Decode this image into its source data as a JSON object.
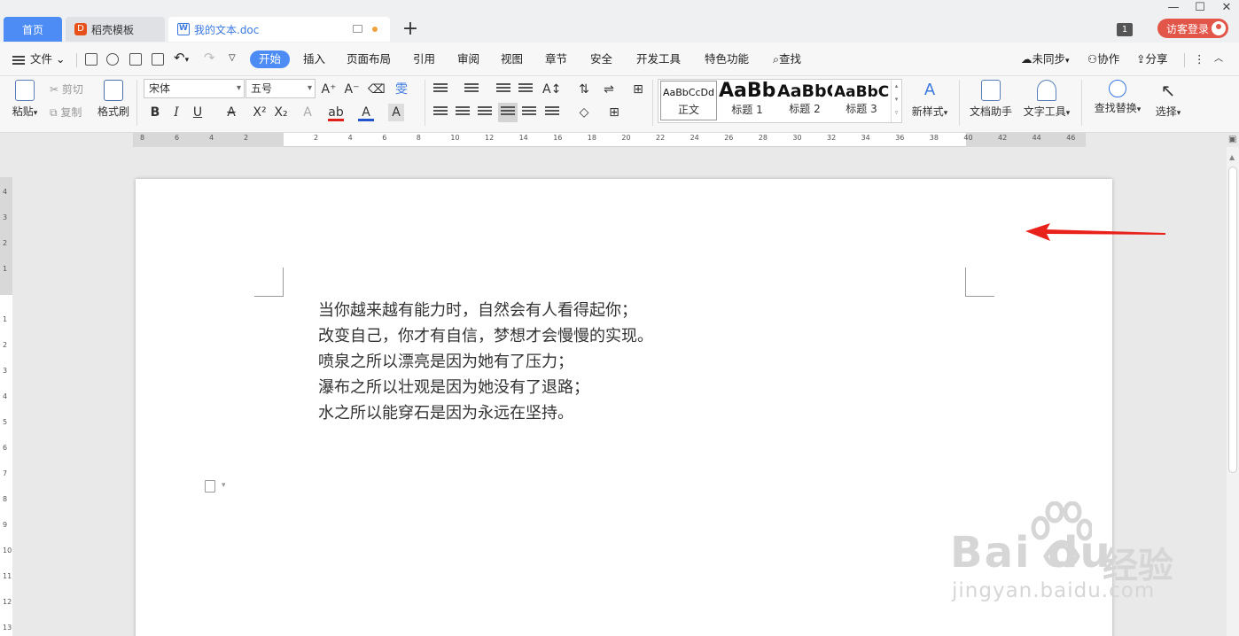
{
  "tabs": {
    "home": "首页",
    "daoke": "稻壳模板",
    "doc": "我的文本.doc"
  },
  "window": {
    "minimize": "—",
    "restore": "☐",
    "close": "✕",
    "badge": "1",
    "login": "访客登录"
  },
  "menu": {
    "file": "文件",
    "items": [
      "开始",
      "插入",
      "页面布局",
      "引用",
      "审阅",
      "视图",
      "章节",
      "安全",
      "开发工具",
      "特色功能"
    ],
    "search": "查找",
    "sync": "未同步",
    "collab": "协作",
    "share": "分享"
  },
  "ribbon": {
    "paste": "粘贴",
    "cut": "剪切",
    "copy": "复制",
    "format_painter": "格式刷",
    "font_name": "宋体",
    "font_size": "五号",
    "styles": [
      {
        "sample": "AaBbCcDd",
        "label": "正文"
      },
      {
        "sample": "AaBb",
        "label": "标题 1"
      },
      {
        "sample": "AaBbC",
        "label": "标题 2"
      },
      {
        "sample": "AaBbCc",
        "label": "标题 3"
      }
    ],
    "new_style": "新样式",
    "doc_helper": "文档助手",
    "text_tools": "文字工具",
    "find_replace": "查找替换",
    "select": "选择"
  },
  "ruler": {
    "h_left": [
      "8",
      "6",
      "4",
      "2"
    ],
    "h_right": [
      "2",
      "4",
      "6",
      "8",
      "10",
      "12",
      "14",
      "16",
      "18",
      "20",
      "22",
      "24",
      "26",
      "28",
      "30",
      "32",
      "34",
      "36",
      "38",
      "40",
      "42",
      "44",
      "46"
    ],
    "v_top": [
      "4",
      "3",
      "2",
      "1"
    ],
    "v_body": [
      "1",
      "2",
      "3",
      "4",
      "5",
      "6",
      "7",
      "8",
      "9",
      "10",
      "11",
      "12",
      "13"
    ]
  },
  "document": {
    "lines": [
      "当你越来越有能力时，自然会有人看得起你；",
      "改变自己，你才有自信，梦想才会慢慢的实现。",
      "喷泉之所以漂亮是因为她有了压力；",
      "瀑布之所以壮观是因为她没有了退路；",
      "水之所以能穿石是因为永远在坚持。"
    ]
  },
  "watermark": {
    "brand": "Bai  du",
    "cn": "经验",
    "url": "jingyan.baidu.com"
  },
  "colors": {
    "accent": "#4d8cf5",
    "arrow": "#e8211b",
    "login": "#e2564a"
  }
}
